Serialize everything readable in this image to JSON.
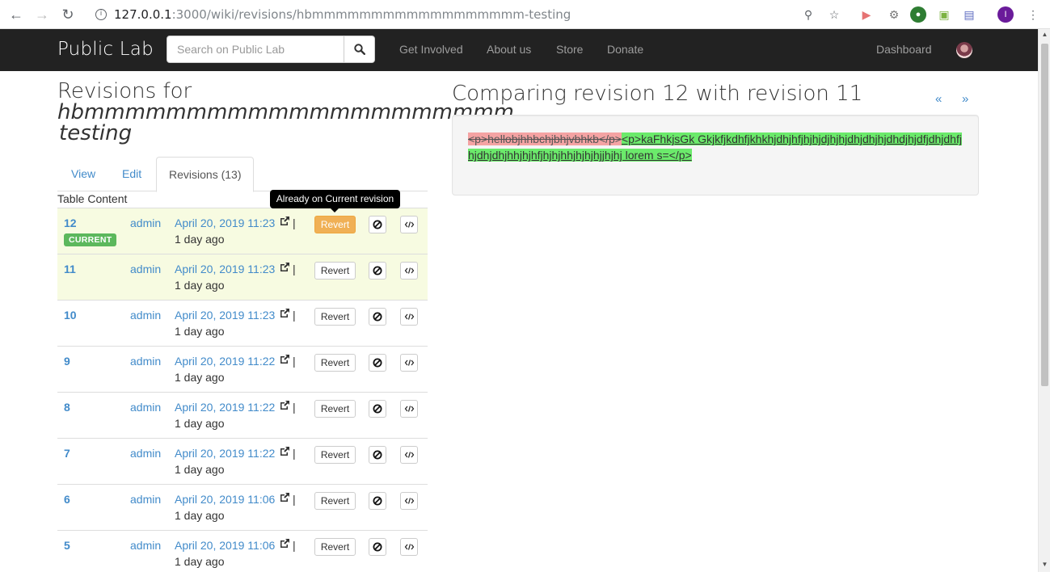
{
  "browser": {
    "url_host": "127.0.0.1",
    "url_path": ":3000/wiki/revisions/hbmmmmmmmmmmmmmmmmmm-testing",
    "profile_initial": "I"
  },
  "navbar": {
    "brand": "Public Lab",
    "search_placeholder": "Search on Public Lab",
    "links": [
      "Get Involved",
      "About us",
      "Store",
      "Donate"
    ],
    "dashboard": "Dashboard"
  },
  "page": {
    "title_prefix": "Revisions for",
    "title_name": "hbmmmmmmmmmmmmmmmmmmmmm",
    "title_suffix": "testing",
    "tabs": [
      "View",
      "Edit",
      "Revisions (13)"
    ],
    "table_caption": "Table Content",
    "tooltip": "Already on Current revision",
    "current_badge": "CURRENT",
    "revert_label": "Revert",
    "revisions": [
      {
        "number": "12",
        "author": "admin",
        "date": "April 20, 2019 11:23",
        "ago": "1 day ago",
        "current": true
      },
      {
        "number": "11",
        "author": "admin",
        "date": "April 20, 2019 11:23",
        "ago": "1 day ago",
        "current": false
      },
      {
        "number": "10",
        "author": "admin",
        "date": "April 20, 2019 11:23",
        "ago": "1 day ago",
        "current": false
      },
      {
        "number": "9",
        "author": "admin",
        "date": "April 20, 2019 11:22",
        "ago": "1 day ago",
        "current": false
      },
      {
        "number": "8",
        "author": "admin",
        "date": "April 20, 2019 11:22",
        "ago": "1 day ago",
        "current": false
      },
      {
        "number": "7",
        "author": "admin",
        "date": "April 20, 2019 11:22",
        "ago": "1 day ago",
        "current": false
      },
      {
        "number": "6",
        "author": "admin",
        "date": "April 20, 2019 11:06",
        "ago": "1 day ago",
        "current": false
      },
      {
        "number": "5",
        "author": "admin",
        "date": "April 20, 2019 11:06",
        "ago": "1 day ago",
        "current": false
      }
    ]
  },
  "compare": {
    "title": "Comparing revision 12 with revision 11",
    "prev": "«",
    "next": "»",
    "deleted": "<p>hellobjhhbchjbhjvbhkb</p>",
    "inserted": "<p>kaFhkjsGk Gkjkfjkdhfjkhkhjdhjhfjhjhjdjhjhjdhjdhjhjdhdjhjdfjdhjdhfjhjdhjdhjhhjhjhfjhjhjhhjhjhjhjjhjhj lorem s=</p>"
  },
  "colors": {
    "navbar_bg": "#222222",
    "link": "#428bca",
    "current_badge": "#5cb85c",
    "revert_current": "#f0ad4e",
    "highlight_row": "#f7fbe1",
    "diff_deleted": "#f4a3a3",
    "diff_inserted": "#6bea6b"
  }
}
